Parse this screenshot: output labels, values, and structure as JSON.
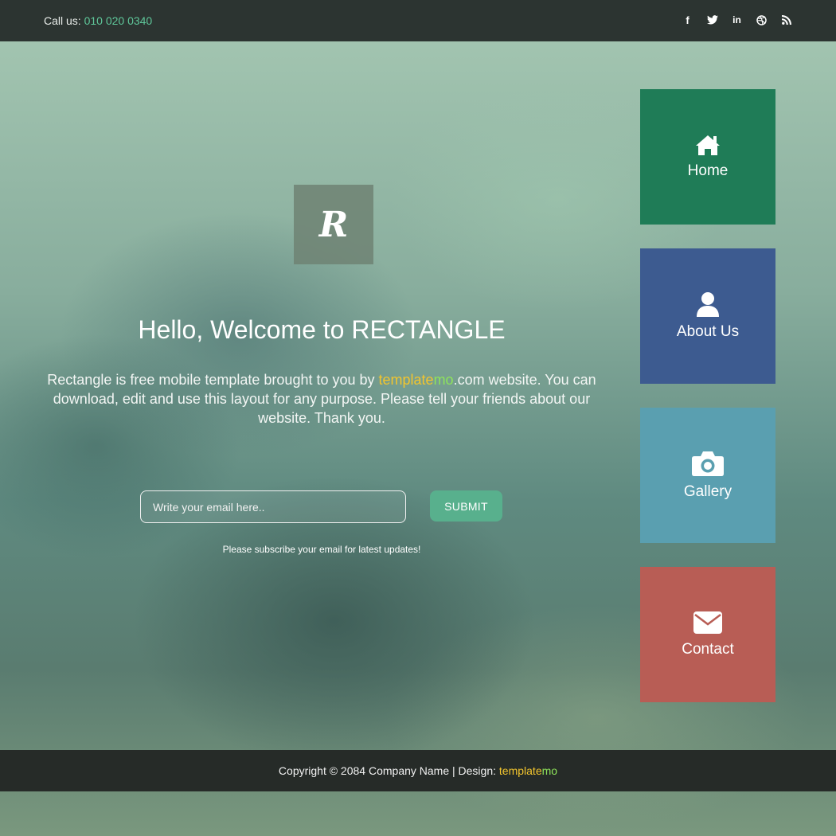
{
  "topbar": {
    "call_label": "Call us: ",
    "phone": "010 020 0340",
    "social": [
      {
        "icon": "facebook-icon",
        "glyph": "f"
      },
      {
        "icon": "twitter-icon",
        "glyph": "t"
      },
      {
        "icon": "linkedin-icon",
        "glyph": "in"
      },
      {
        "icon": "dribbble-icon",
        "glyph": "⊛"
      },
      {
        "icon": "rss-icon",
        "glyph": "))"
      }
    ]
  },
  "logo": {
    "letter": "R"
  },
  "hero": {
    "title_prefix": "Hello, Welcome to ",
    "title_brand": "RECTANGLE",
    "intro_before": "Rectangle is free mobile template brought to you by ",
    "brand_a": "template",
    "brand_b": "mo",
    "intro_after": ".com website. You can download, edit and use this layout for any purpose. Please tell your friends about our website. Thank you."
  },
  "subscribe": {
    "placeholder": "Write your email here..",
    "submit_label": "SUBMIT",
    "note": "Please subscribe your email for latest updates!"
  },
  "nav": [
    {
      "label": "Home",
      "icon": "home-icon",
      "color": "#1f7c57"
    },
    {
      "label": "About Us",
      "icon": "user-icon",
      "color": "#3d5b90"
    },
    {
      "label": "Gallery",
      "icon": "camera-icon",
      "color": "#5a9fb0"
    },
    {
      "label": "Contact",
      "icon": "envelope-icon",
      "color": "#b85d55"
    }
  ],
  "footer": {
    "text": "Copyright © 2084 Company Name | Design: ",
    "brand_a": "template",
    "brand_b": "mo"
  },
  "colors": {
    "accent_green": "#5fc79a",
    "submit_bg": "#58b08d",
    "brand_yellow": "#f2c52e",
    "brand_green": "#8ee45a"
  }
}
